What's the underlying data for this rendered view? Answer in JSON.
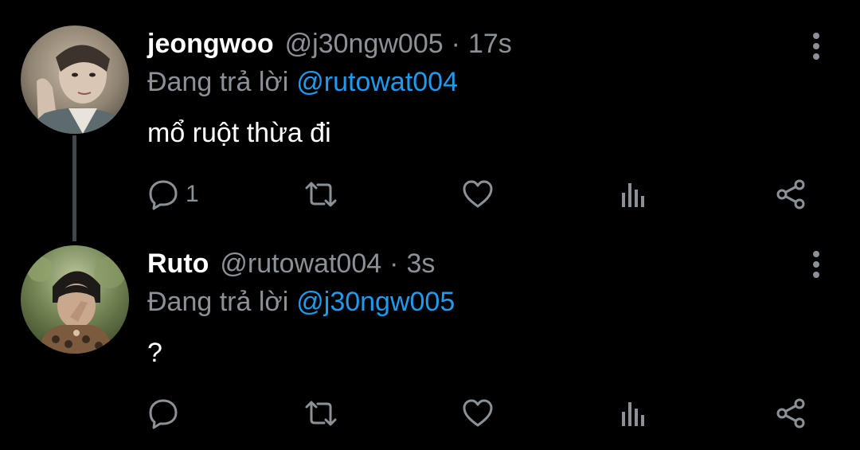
{
  "colors": {
    "background": "#000000",
    "text_primary": "#ffffff",
    "text_secondary": "#8b9197",
    "link": "#1d9bf0",
    "thread_line": "#42474c"
  },
  "tweets": [
    {
      "display_name": "jeongwoo",
      "handle": "@j30ngw005",
      "separator": "·",
      "time": "17s",
      "replying_prefix": "Đang trả lời",
      "replying_to": "@rutowat004",
      "text": "mổ ruột thừa đi",
      "reply_count": "1",
      "avatar_icon": "user-avatar-photo"
    },
    {
      "display_name": "Ruto",
      "handle": "@rutowat004",
      "separator": "·",
      "time": "3s",
      "replying_prefix": "Đang trả lời",
      "replying_to": "@j30ngw005",
      "text": "?",
      "reply_count": "",
      "avatar_icon": "user-avatar-photo"
    }
  ],
  "icons": {
    "reply": "reply-icon",
    "retweet": "retweet-icon",
    "like": "heart-icon",
    "views": "views-icon",
    "share": "share-icon",
    "more": "more-vertical-icon"
  }
}
